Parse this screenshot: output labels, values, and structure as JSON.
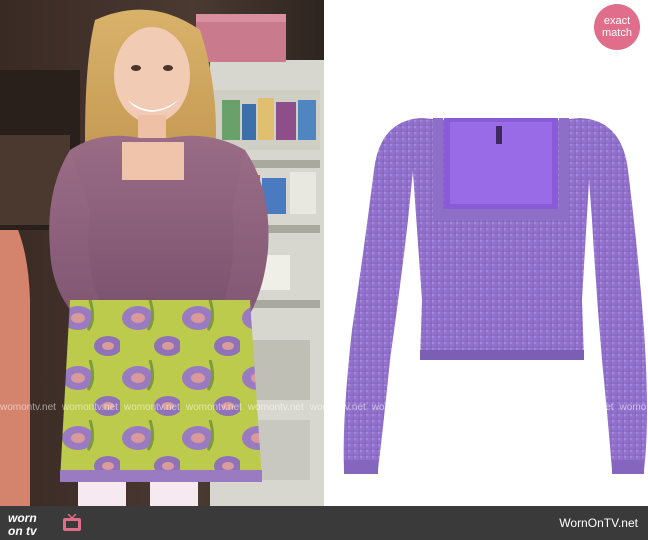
{
  "badge": {
    "line1": "exact",
    "line2": "match"
  },
  "watermark": {
    "text": "womontv.net",
    "repeat": 20
  },
  "footer": {
    "logo_line1": "worn",
    "logo_line2": "on tv",
    "site_name": "WornOnTV.net"
  },
  "colors": {
    "badge": "#e06d8a",
    "footer_bar": "#3a3a3a",
    "top_purple": "#9b72d6",
    "skirt_yellow": "#b9c94a",
    "skirt_purple": "#9a7bc2"
  }
}
